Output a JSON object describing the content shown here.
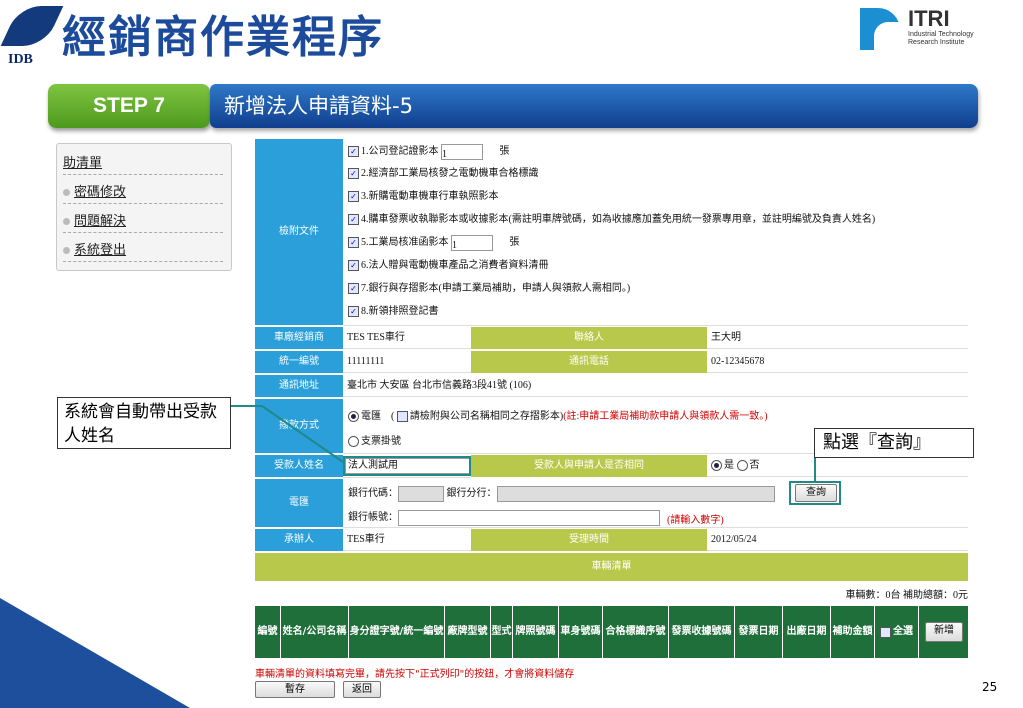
{
  "header": {
    "org_logo_text": "IDB",
    "title": "經銷商作業程序",
    "itri_name": "ITRI",
    "itri_sub1": "Industrial Technology",
    "itri_sub2": "Research Institute"
  },
  "step": {
    "label": "STEP 7",
    "title": "新增法人申請資料-5"
  },
  "sidebar": {
    "items": [
      "助清單",
      "密碼修改",
      "問題解決",
      "系統登出"
    ]
  },
  "callouts": {
    "left": "系統會自動帶出受款人姓名",
    "right": "點選『查詢』"
  },
  "form": {
    "attachments_label": "檢附文件",
    "attachments": [
      "1.公司登記證影本",
      "2.經濟部工業局核發之電動機車合格標識",
      "3.新購電動車機車行車執照影本",
      "4.購車發票收執聯影本或收據影本(需註明車牌號碼，如為收據應加蓋免用統一發票專用章，並註明編號及負責人姓名)",
      "5.工業局核准函影本",
      "6.法人贈與電動機車產品之消費者資料清冊",
      "7.銀行與存摺影本(申請工業局補助，申請人與領款人需相同。)",
      "8.新領排照登記書"
    ],
    "att1_qty": "1",
    "att5_qty": "1",
    "unit": "張",
    "dealer_label": "車廠經銷商",
    "dealer_value": "TES TES車行",
    "contact_label": "聯絡人",
    "contact_value": "王大明",
    "taxid_label": "統一編號",
    "taxid_value": "11111111",
    "phone_label": "通訊電話",
    "phone_value": "02-12345678",
    "address_label": "通訊地址",
    "address_value": "臺北市 大安區 台北市信義路3段41號 (106)",
    "payment_label": "撥款方式",
    "pay_wire": "電匯",
    "pay_same_note": "請檢附與公司名稱相同之存摺影本",
    "pay_red_note": "(註:申請工業局補助款申請人與領款人需一致。)",
    "pay_check": "支票掛號",
    "payee_label": "受款人姓名",
    "payee_value": "法人測試用",
    "same_label": "受款人與申請人是否相同",
    "yes": "是",
    "no": "否",
    "wire_label": "電匯",
    "bank_code": "銀行代碼：",
    "bank_branch": "銀行分行：",
    "query_btn": "查詢",
    "account_label": "銀行帳號：",
    "account_note": "(請輸入數字)",
    "handler_label": "承辦人",
    "handler_value": "TES車行",
    "accept_label": "受理時間",
    "accept_value": "2012/05/24",
    "vehicles_title": "車輛清單",
    "vehicles_count": "車輛數：0台 補助總額：0元"
  },
  "vehicle_table": {
    "headers": [
      "編號",
      "姓名/公司名稱",
      "身分證字號/統一編號",
      "廠牌型號",
      "型式",
      "牌照號碼",
      "車身號碼",
      "合格標識序號",
      "發票收據號碼",
      "發票日期",
      "出廠日期",
      "補助金額",
      "全選"
    ],
    "add_btn": "新增"
  },
  "notice": "車輛清單的資料填寫完畢，請先按下\"正式列印\"的按鈕，才會將資料儲存",
  "buttons": {
    "save": "暫存",
    "back": "返回"
  },
  "page_number": "25"
}
